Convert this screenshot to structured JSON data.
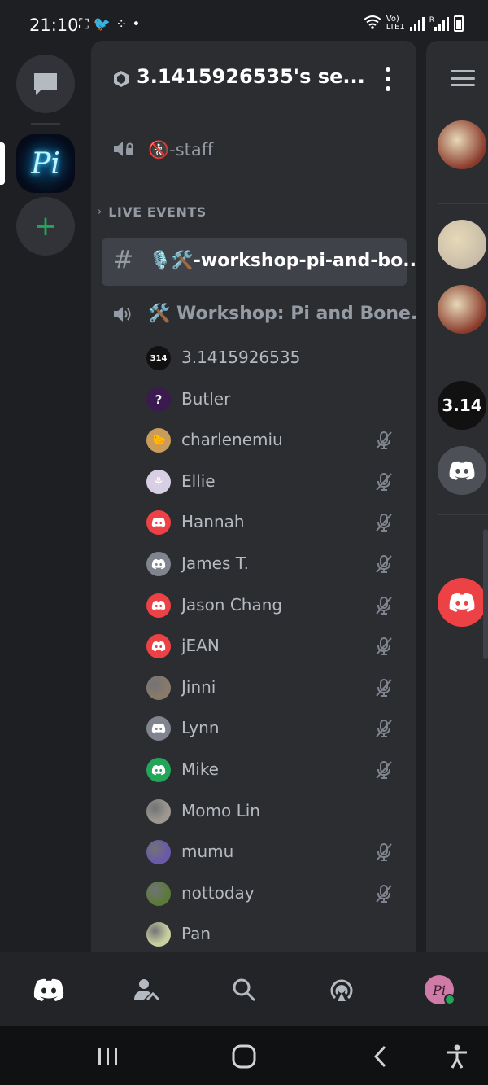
{
  "status_bar": {
    "time": "21:10",
    "left_icons": [
      "screenshot-icon",
      "twitter-icon",
      "fitbit-icon",
      "dot-icon"
    ],
    "right_labels": {
      "volte": "Vo)",
      "lte": "LTE1",
      "r": "R"
    }
  },
  "server": {
    "name": "3.1415926535's se...",
    "rail_monogram": "Pi"
  },
  "channels": [
    {
      "type": "voice",
      "label": "🚷-staff",
      "icon": "speaker-lock-icon"
    }
  ],
  "category": {
    "label": "LIVE EVENTS",
    "icon": "chevron-right-icon"
  },
  "selected_channel": {
    "label": "🎙️🛠️-workshop-pi-and-bo...",
    "icon": "hash-icon"
  },
  "voice_channel": {
    "label": "🛠️ Workshop: Pi and Bone...",
    "icon": "speaker-icon",
    "members": [
      {
        "name": "3.1415926535",
        "avatar": "314",
        "avatar_color": "#111111",
        "muted": false
      },
      {
        "name": "Butler",
        "avatar": "?",
        "avatar_color": "#3b1b4f",
        "muted": false
      },
      {
        "name": "charlenemiu",
        "avatar": "🐤",
        "avatar_color": "#c99c5b",
        "muted": true
      },
      {
        "name": "Ellie",
        "avatar": "⚘",
        "avatar_color": "#d9cfe5",
        "muted": true
      },
      {
        "name": "Hannah",
        "avatar": "discord",
        "avatar_color": "#ed4245",
        "muted": true
      },
      {
        "name": "James T.",
        "avatar": "discord",
        "avatar_color": "#80848e",
        "muted": true
      },
      {
        "name": "Jason Chang",
        "avatar": "discord",
        "avatar_color": "#ed4245",
        "muted": true
      },
      {
        "name": "jEAN",
        "avatar": "discord",
        "avatar_color": "#ed4245",
        "muted": true
      },
      {
        "name": "Jinni",
        "avatar": "photo",
        "avatar_color": "#8a7a6a",
        "muted": true
      },
      {
        "name": "Lynn",
        "avatar": "discord",
        "avatar_color": "#80848e",
        "muted": true
      },
      {
        "name": "Mike",
        "avatar": "discord",
        "avatar_color": "#23a55a",
        "muted": true
      },
      {
        "name": "Momo Lin",
        "avatar": "photo",
        "avatar_color": "#9e9890",
        "muted": false
      },
      {
        "name": "mumu",
        "avatar": "photo",
        "avatar_color": "#6a5aa8",
        "muted": true
      },
      {
        "name": "nottoday",
        "avatar": "photo",
        "avatar_color": "#5b7a3a",
        "muted": true
      },
      {
        "name": "Pan",
        "avatar": "photo",
        "avatar_color": "#c9d0a0",
        "muted": false
      }
    ]
  },
  "right_pane": {
    "avatars": [
      {
        "kind": "photo",
        "color": "#8a3a2a"
      },
      {
        "kind": "photo",
        "color": "#c8bca8"
      },
      {
        "kind": "photo",
        "color": "#8a3a2a"
      },
      {
        "kind": "text",
        "label": "3.14",
        "color": "#111111"
      },
      {
        "kind": "discord",
        "color": "#4e5058"
      },
      {
        "kind": "discord",
        "color": "#ed4245"
      }
    ]
  },
  "bottom_nav": {
    "items": [
      "home-discord-icon",
      "friends-icon",
      "search-icon",
      "mentions-icon",
      "profile-avatar"
    ]
  },
  "system_nav": {
    "items": [
      "recent-apps-icon",
      "home-icon",
      "back-icon",
      "accessibility-icon"
    ]
  },
  "colors": {
    "background": "#1e1f22",
    "panel": "#2b2d31",
    "selected": "#404249",
    "muted_text": "#949ba4",
    "member_text": "#b5bac1",
    "online_green": "#23a55a"
  }
}
